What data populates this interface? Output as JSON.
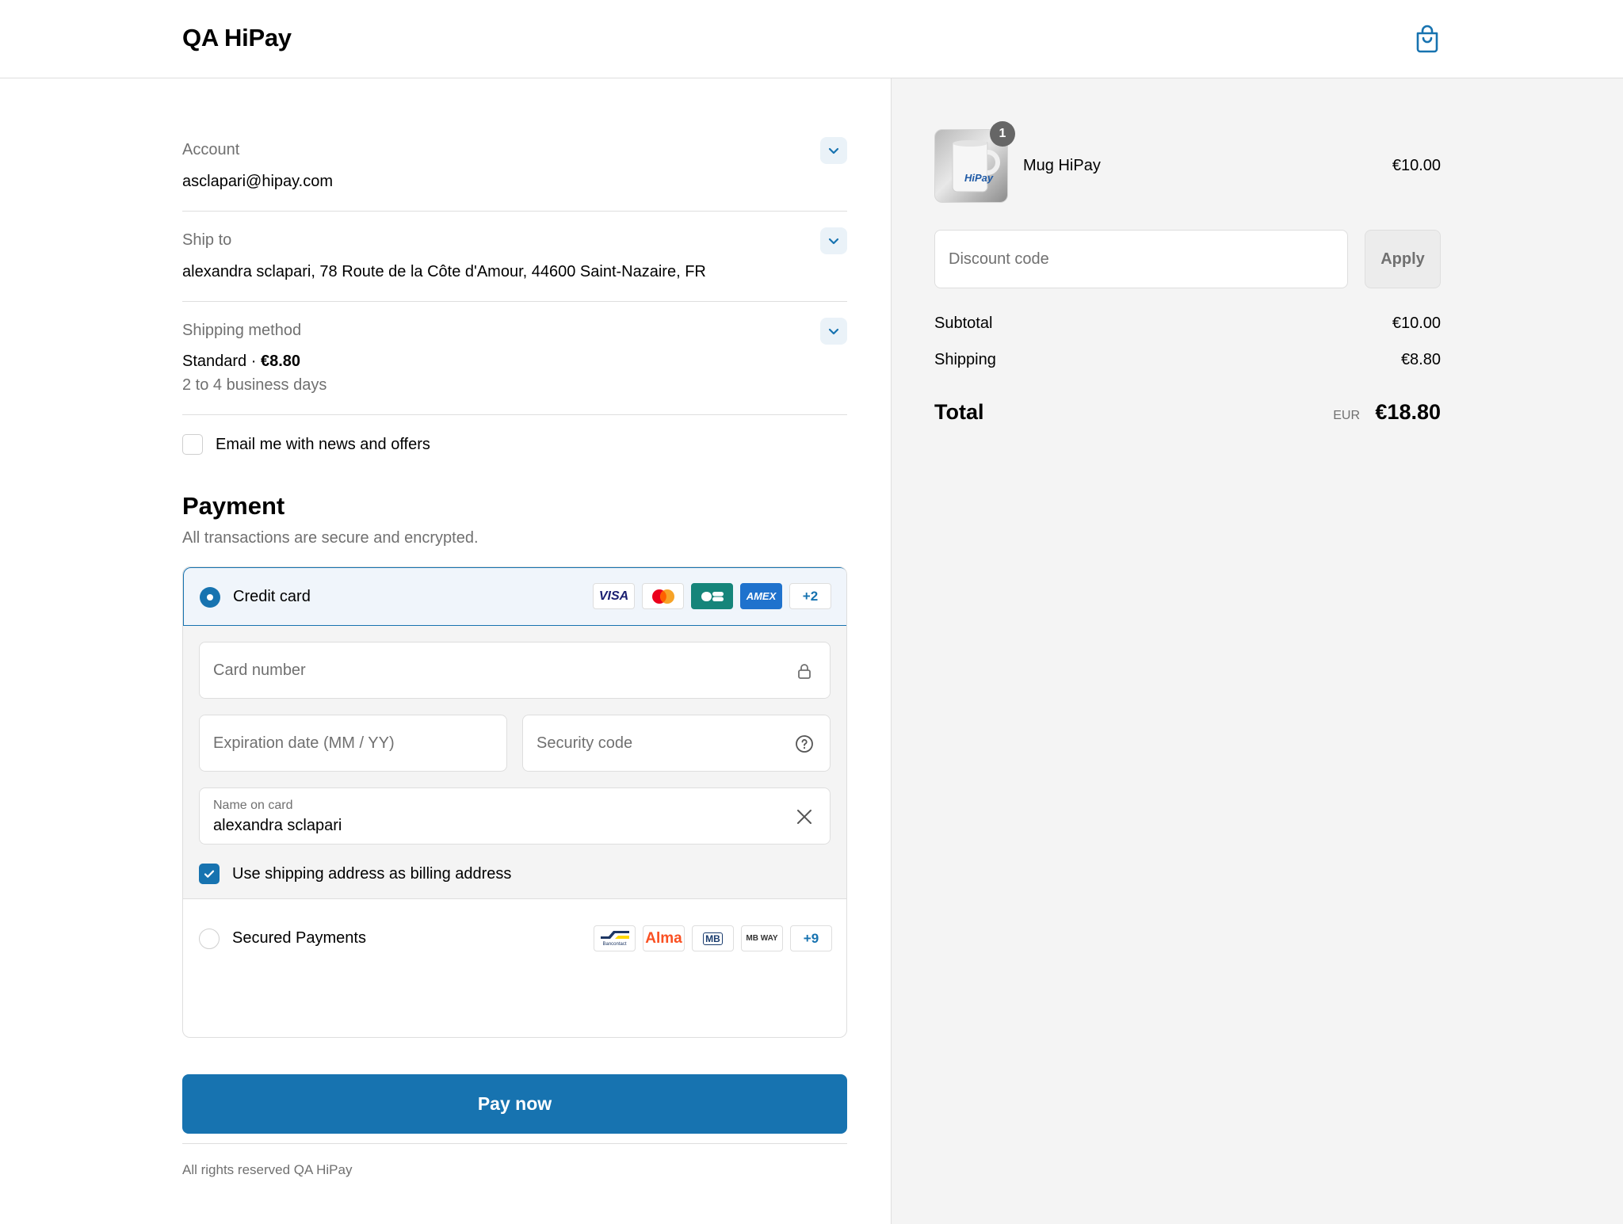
{
  "header": {
    "shop_name": "QA HiPay",
    "cart_icon": "shopping-bag-icon"
  },
  "review": {
    "account": {
      "label": "Account",
      "value": "asclapari@hipay.com"
    },
    "ship_to": {
      "label": "Ship to",
      "value": "alexandra sclapari, 78 Route de la Côte d'Amour, 44600 Saint-Nazaire, FR"
    },
    "shipping_method": {
      "label": "Shipping method",
      "name": "Standard",
      "separator": "·",
      "price": "€8.80",
      "detail": "2 to 4 business days"
    }
  },
  "newsletter": {
    "label": "Email me with news and offers",
    "checked": false
  },
  "payment": {
    "title": "Payment",
    "subtitle": "All transactions are secure and encrypted.",
    "credit_card": {
      "label": "Credit card",
      "selected": true,
      "badges": [
        "VISA",
        "Mastercard",
        "CB",
        "AMEX"
      ],
      "badges_more": "+2",
      "card_number_placeholder": "Card number",
      "expiry_placeholder": "Expiration date (MM / YY)",
      "security_placeholder": "Security code",
      "name_label": "Name on card",
      "name_value": "alexandra sclapari",
      "billing_label": "Use shipping address as billing address",
      "billing_checked": true
    },
    "secured": {
      "label": "Secured Payments",
      "selected": false,
      "badges": [
        "Bancontact",
        "Alma",
        "MB",
        "MB WAY"
      ],
      "badges_more": "+9"
    },
    "pay_button": "Pay now"
  },
  "footer": {
    "text": "All rights reserved QA HiPay"
  },
  "summary": {
    "item": {
      "name": "Mug HiPay",
      "quantity": "1",
      "price": "€10.00",
      "thumb_text": "HiPay"
    },
    "discount_placeholder": "Discount code",
    "apply_label": "Apply",
    "subtotal_label": "Subtotal",
    "subtotal_value": "€10.00",
    "shipping_label": "Shipping",
    "shipping_value": "€8.80",
    "total_label": "Total",
    "currency": "EUR",
    "total_value": "€18.80"
  },
  "colors": {
    "accent": "#1773b0",
    "panel": "#f4f4f4",
    "muted": "#707070",
    "border": "#dedede"
  }
}
